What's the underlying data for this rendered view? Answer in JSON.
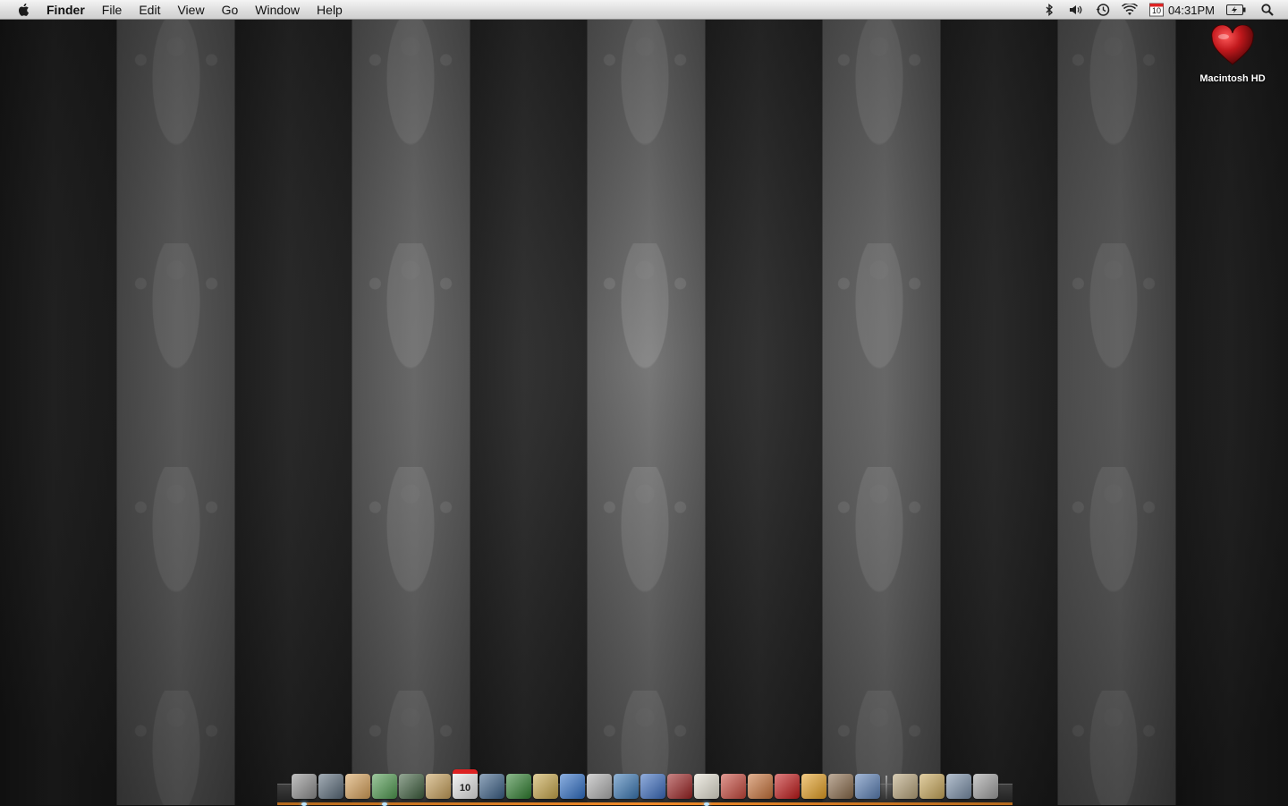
{
  "menubar": {
    "app_name": "Finder",
    "menus": [
      "File",
      "Edit",
      "View",
      "Go",
      "Window",
      "Help"
    ],
    "calendar_day": "10",
    "clock": "04:31PM",
    "status_icons": [
      "bluetooth-icon",
      "volume-icon",
      "time-machine-icon",
      "wifi-icon",
      "calendar-icon",
      "battery-icon",
      "spotlight-icon"
    ]
  },
  "desktop": {
    "icons": [
      {
        "label": "Macintosh HD",
        "icon": "heart-drive-icon",
        "color": "#c0181c"
      }
    ]
  },
  "dock": {
    "accent": "#f08a2a",
    "calendar_day": "10",
    "apps": [
      {
        "icon": "finder-icon",
        "color": "#8f8f8f",
        "running": true
      },
      {
        "icon": "dashboard-icon",
        "color": "#5a6b7a",
        "running": false
      },
      {
        "icon": "mail-icon",
        "color": "#d8a25a",
        "running": false
      },
      {
        "icon": "maps-icon",
        "color": "#4f9a4f",
        "running": true
      },
      {
        "icon": "address-book-icon",
        "color": "#3e5f3e",
        "running": false
      },
      {
        "icon": "quill-icon",
        "color": "#c7a05a",
        "running": false
      },
      {
        "icon": "ical-icon",
        "color": "#e8e8e8",
        "running": false
      },
      {
        "icon": "xcode-icon",
        "color": "#3a5f86",
        "running": false
      },
      {
        "icon": "stocks-icon",
        "color": "#2f7f2f",
        "running": false
      },
      {
        "icon": "compass-icon",
        "color": "#c8a74a",
        "running": false
      },
      {
        "icon": "todo-icon",
        "color": "#2f6fc7",
        "running": false
      },
      {
        "icon": "photo-booth-icon",
        "color": "#b0b0b0",
        "running": false
      },
      {
        "icon": "globe-icon",
        "color": "#3a78b5",
        "running": false
      },
      {
        "icon": "pen-icon",
        "color": "#3a6cc0",
        "running": false
      },
      {
        "icon": "dictionary-icon",
        "color": "#9c2222",
        "running": false
      },
      {
        "icon": "book-icon",
        "color": "#e4e0d2",
        "running": true
      },
      {
        "icon": "envelope-icon",
        "color": "#c7473a",
        "running": false
      },
      {
        "icon": "preview-icon",
        "color": "#c9733a",
        "running": false
      },
      {
        "icon": "record-icon",
        "color": "#c21818",
        "running": false
      },
      {
        "icon": "jar-icon",
        "color": "#e6a022",
        "running": false
      },
      {
        "icon": "script-icon",
        "color": "#8a6b4b",
        "running": false
      },
      {
        "icon": "spaces-icon",
        "color": "#5a7fb5",
        "running": false
      }
    ],
    "stacks": [
      {
        "icon": "downloads-stack-icon",
        "color": "#b8a47a"
      },
      {
        "icon": "documents-stack-icon",
        "color": "#c9a85a"
      },
      {
        "icon": "applications-stack-icon",
        "color": "#7a8fa8"
      },
      {
        "icon": "trash-icon",
        "color": "#a0a0a0"
      }
    ]
  }
}
